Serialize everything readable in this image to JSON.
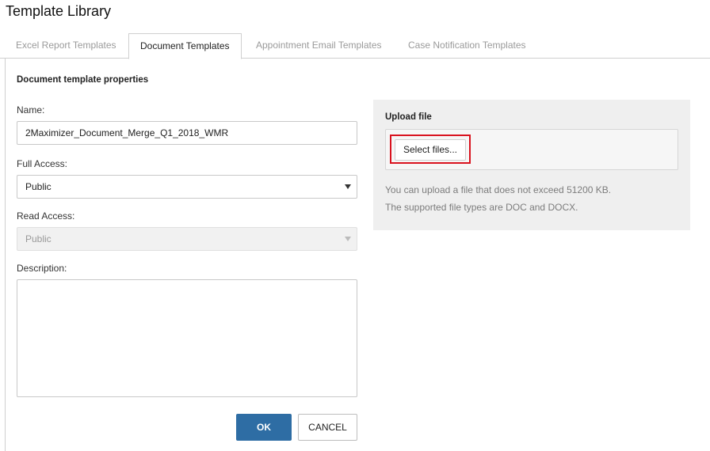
{
  "page": {
    "title": "Template Library"
  },
  "tabs": [
    {
      "label": "Excel Report Templates",
      "active": false
    },
    {
      "label": "Document Templates",
      "active": true
    },
    {
      "label": "Appointment Email Templates",
      "active": false
    },
    {
      "label": "Case Notification Templates",
      "active": false
    }
  ],
  "form": {
    "section_title": "Document template properties",
    "name_label": "Name:",
    "name_value": "2Maximizer_Document_Merge_Q1_2018_WMR",
    "full_access_label": "Full Access:",
    "full_access_value": "Public",
    "read_access_label": "Read Access:",
    "read_access_value": "Public",
    "description_label": "Description:",
    "description_value": ""
  },
  "upload": {
    "title": "Upload file",
    "select_button_label": "Select files...",
    "info_size": "You can upload a file that does not exceed 51200 KB.",
    "info_types": "The supported file types are DOC and DOCX."
  },
  "buttons": {
    "ok_label": "OK",
    "cancel_label": "CANCEL"
  },
  "colors": {
    "primary": "#2e6da4",
    "highlight": "#d9121e",
    "panel_bg": "#efefef"
  }
}
